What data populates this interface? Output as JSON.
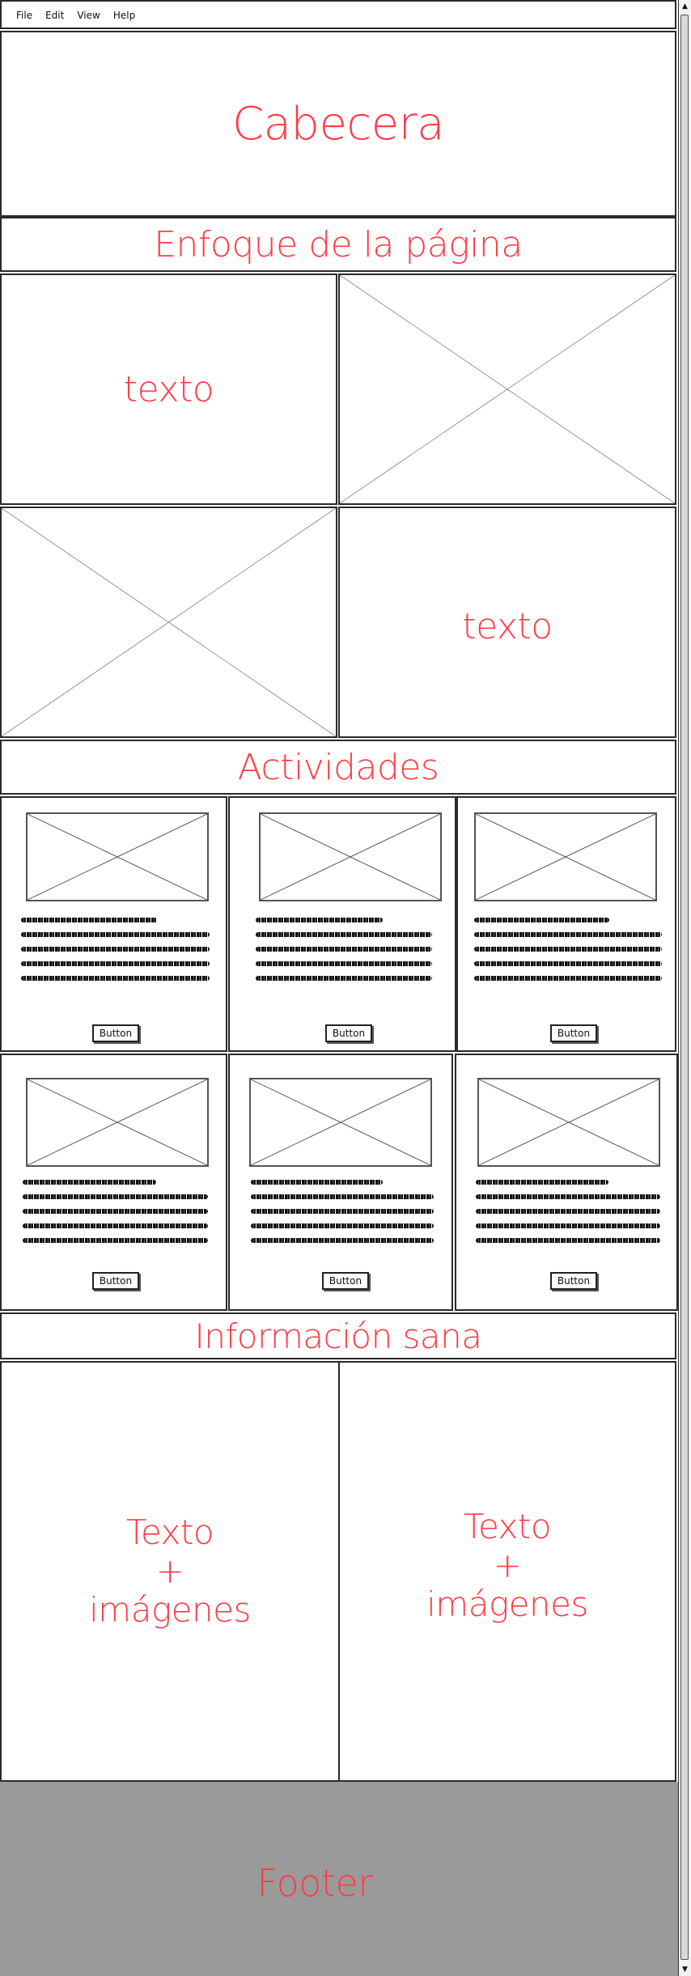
{
  "menubar": {
    "items": [
      "File",
      "Edit",
      "View",
      "Help"
    ]
  },
  "header": {
    "title": "Cabecera"
  },
  "focus": {
    "title": "Enfoque de la página",
    "row1_text": "texto",
    "row2_text": "texto"
  },
  "activities": {
    "title": "Actividades",
    "button_label": "Button"
  },
  "health": {
    "title": "Información sana",
    "left": [
      "Texto",
      "+",
      "imágenes"
    ],
    "right": [
      "Texto",
      "+",
      "imágenes"
    ]
  },
  "footer": {
    "label": "Footer"
  },
  "colors": {
    "annotation": "#ff3c46",
    "footer_bg": "#9a9a9a",
    "border": "#2a2a2a"
  },
  "icons": {
    "placeholder": "image-placeholder-icon",
    "scroll_up": "arrow-up-icon",
    "scroll_down": "arrow-down-icon"
  }
}
